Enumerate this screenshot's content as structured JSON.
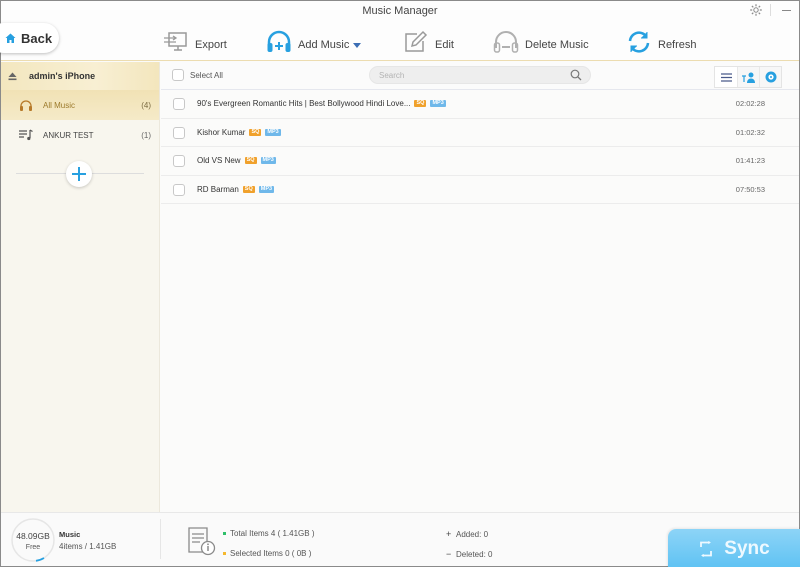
{
  "window": {
    "title": "Music Manager"
  },
  "toolbar": {
    "back_label": "Back",
    "export_label": "Export",
    "add_music_label": "Add Music",
    "edit_label": "Edit",
    "delete_music_label": "Delete Music",
    "refresh_label": "Refresh"
  },
  "sidebar": {
    "device_name": "admin's iPhone",
    "items": [
      {
        "label": "All Music",
        "count": "(4)",
        "icon": "headphones-icon",
        "active": true
      },
      {
        "label": "ANKUR TEST",
        "count": "(1)",
        "icon": "playlist-icon",
        "active": false
      }
    ]
  },
  "list": {
    "select_all_label": "Select All",
    "search_placeholder": "Search",
    "rows": [
      {
        "title": "90's Evergreen Romantic Hits | Best Bollywood Hindi Love...",
        "badges": [
          "SQ",
          "MP3"
        ],
        "duration": "02:02:28"
      },
      {
        "title": "Kishor Kumar",
        "badges": [
          "SQ",
          "MP3"
        ],
        "duration": "01:02:32"
      },
      {
        "title": "Old VS New",
        "badges": [
          "SQ",
          "MP3"
        ],
        "duration": "01:41:23"
      },
      {
        "title": "RD Barman",
        "badges": [
          "SQ",
          "MP3"
        ],
        "duration": "07:50:53"
      }
    ]
  },
  "footer": {
    "free_space": "48.09GB",
    "free_label": "Free",
    "category": "Music",
    "category_summary": "4items / 1.41GB",
    "total_items": "Total Items 4 ( 1.41GB )",
    "selected_items": "Selected Items 0 ( 0B )",
    "added": "Added: 0",
    "deleted": "Deleted: 0",
    "sync_label": "Sync"
  },
  "colors": {
    "accent": "#27a0e0",
    "sync_button": "#6ec8f4",
    "sq_badge": "#f0a12c",
    "mp3_badge": "#6fb8ea",
    "active_item": "#f1e2b5",
    "total_dot": "#2fbf6a",
    "selected_dot": "#f5b82e"
  }
}
